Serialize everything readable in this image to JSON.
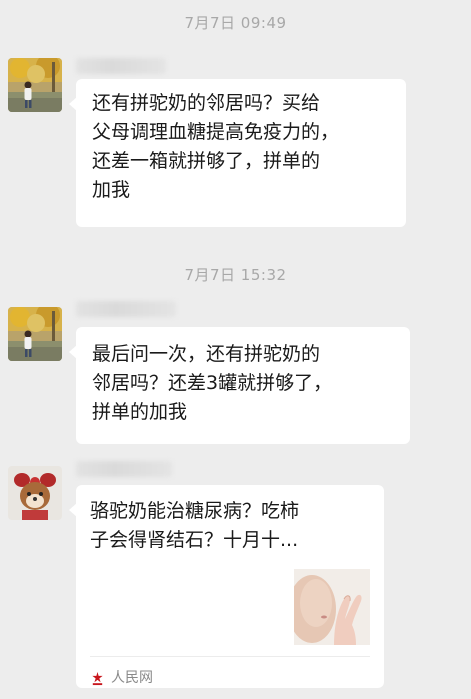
{
  "messages": [
    {
      "timestamp": "7月7日 09:49",
      "lines": [
        "还有拼驼奶的邻居吗？买给",
        "父母调理血糖提高免疫力的，",
        "还差一箱就拼够了，拼单的",
        "加我"
      ]
    },
    {
      "timestamp": "7月7日 15:32",
      "lines": [
        "最后问一次，还有拼驼奶的",
        "邻居吗？还差3罐就拼够了，",
        "拼单的加我"
      ]
    }
  ],
  "link_card": {
    "title_lines": [
      "骆驼奶能治糖尿病？吃柿",
      "子会得肾结石？十月十..."
    ],
    "source": "人民网",
    "source_icon": "people-daily-logo-icon",
    "thumbnail": "hand-near-face-thumbnail"
  },
  "colors": {
    "background": "#ededed",
    "bubble": "#ffffff",
    "timestamp_text": "#a8a8a8",
    "source_logo": "#c8161d"
  }
}
